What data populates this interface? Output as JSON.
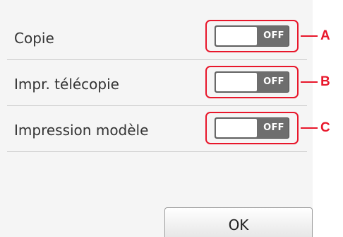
{
  "settings": {
    "rows": [
      {
        "label": "Copie",
        "toggle": "OFF",
        "callout": "A"
      },
      {
        "label": "Impr. télécopie",
        "toggle": "OFF",
        "callout": "B"
      },
      {
        "label": "Impression modèle",
        "toggle": "OFF",
        "callout": "C"
      }
    ]
  },
  "footer": {
    "ok_label": "OK"
  },
  "colors": {
    "callout_red": "#e8172b",
    "toggle_off": "#6e6e6e",
    "panel_background": "#f5f5f5"
  }
}
